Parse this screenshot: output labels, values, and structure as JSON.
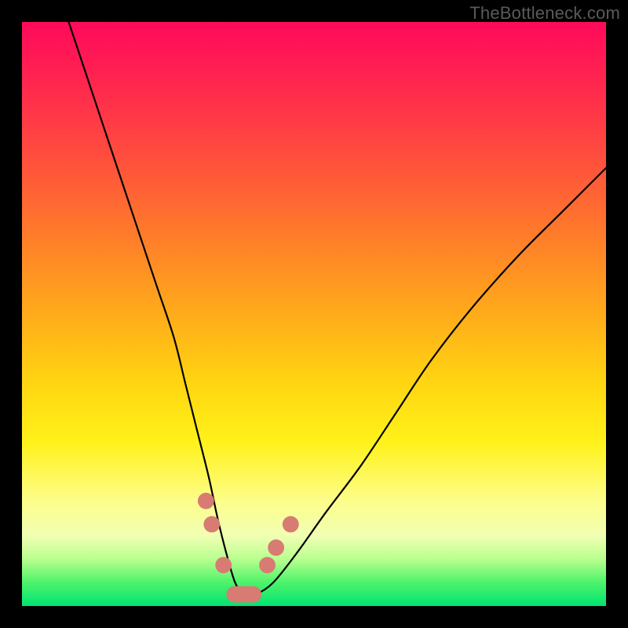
{
  "watermark": "TheBottleneck.com",
  "chart_data": {
    "type": "line",
    "title": "",
    "xlabel": "",
    "ylabel": "",
    "xlim": [
      0,
      100
    ],
    "ylim": [
      0,
      100
    ],
    "grid": false,
    "legend": false,
    "series": [
      {
        "name": "bottleneck-curve",
        "x": [
          8,
          11,
          14,
          17,
          20,
          23,
          26,
          28,
          30,
          32,
          33.5,
          35,
          36.5,
          38,
          40,
          43,
          47,
          52,
          58,
          64,
          70,
          77,
          85,
          93,
          100
        ],
        "y": [
          100,
          91,
          82,
          73,
          64,
          55,
          46,
          38,
          30,
          22,
          15,
          9,
          4,
          2,
          2,
          4,
          9,
          16,
          24,
          33,
          42,
          51,
          60,
          68,
          75
        ]
      }
    ],
    "annotations": {
      "beads_left": [
        {
          "x": 31.5,
          "y": 18
        },
        {
          "x": 32.5,
          "y": 14
        },
        {
          "x": 34.5,
          "y": 7
        }
      ],
      "beads_right": [
        {
          "x": 42.0,
          "y": 7
        },
        {
          "x": 43.5,
          "y": 10
        },
        {
          "x": 46.0,
          "y": 14
        }
      ],
      "valley_bar": {
        "x0": 35,
        "x1": 41,
        "y": 2
      },
      "bead_radius_pct": 1.4
    },
    "colors": {
      "curve": "#000000",
      "beads": "#d77b73",
      "frame": "#000000",
      "gradient_stops": [
        "#ff0a5a",
        "#ff7a2b",
        "#ffd611",
        "#fdfd8a",
        "#00e472"
      ]
    }
  }
}
